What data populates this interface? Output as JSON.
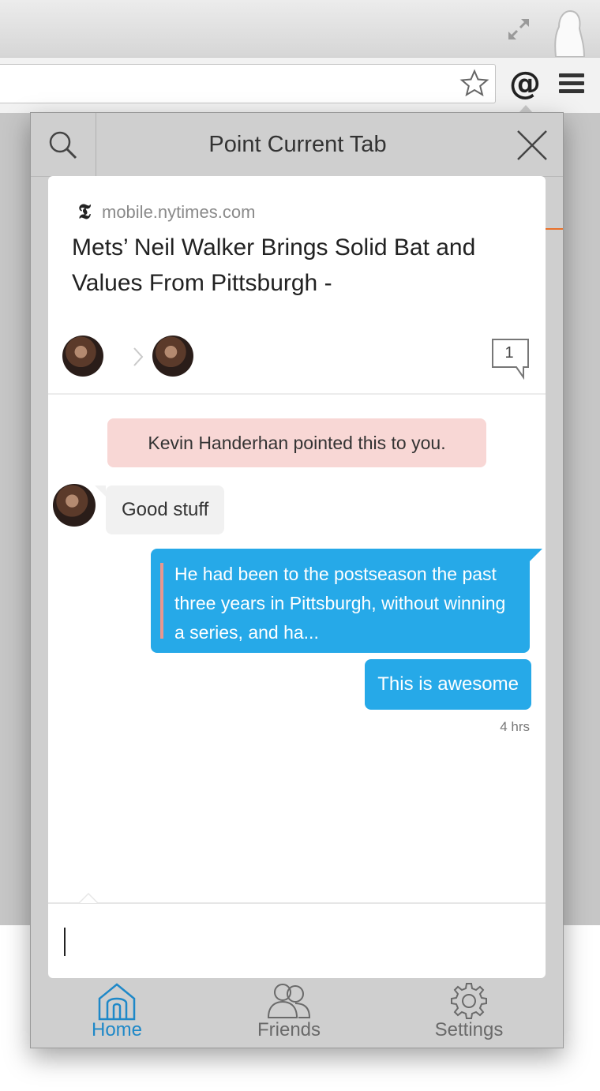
{
  "browser": {
    "icons": {
      "expand": "expand-icon",
      "profile": "profile-icon",
      "bookmark": "star-icon",
      "extension": "at-sign-icon",
      "menu": "hamburger-menu-icon"
    },
    "extension_glyph": "@"
  },
  "popup": {
    "title": "Point Current Tab",
    "article": {
      "publisher_glyph": "𝕿",
      "domain": "mobile.nytimes.com",
      "title": "Mets’ Neil Walker Brings Solid Bat and Values From Pittsburgh -",
      "comment_count": "1"
    },
    "conversation": {
      "notice": "Kevin Handerhan pointed this to you.",
      "messages": [
        {
          "direction": "incoming",
          "text": "Good stuff"
        },
        {
          "direction": "outgoing",
          "type": "quote",
          "text": "He had been to the postseason the past three years in Pittsburgh, without winning a series, and ha..."
        },
        {
          "direction": "outgoing",
          "text": "This is awesome"
        }
      ],
      "time": "4 hrs"
    },
    "composer": {
      "value": "",
      "placeholder": ""
    },
    "nav": [
      {
        "label": "Home",
        "icon": "home-icon",
        "active": true
      },
      {
        "label": "Friends",
        "icon": "friends-icon",
        "active": false
      },
      {
        "label": "Settings",
        "icon": "gear-icon",
        "active": false
      }
    ],
    "colors": {
      "accent": "#26a9e8",
      "notice_bg": "#f8d7d5",
      "nav_active": "#1e88c8",
      "nav_inactive": "#6a6a6a"
    }
  }
}
